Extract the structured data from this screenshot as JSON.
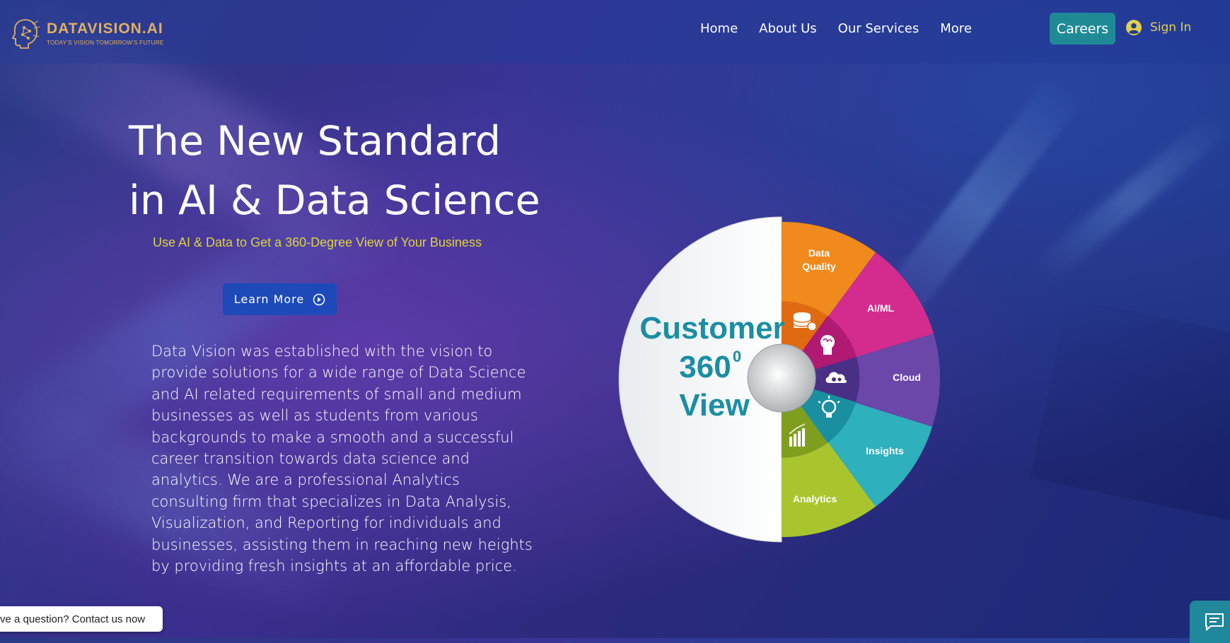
{
  "brand": {
    "name": "DATAVISION.AI",
    "tagline": "TODAY'S VISION TOMORROW'S FUTURE",
    "accent": "#e0b060"
  },
  "nav": {
    "items": [
      "Home",
      "About Us",
      "Our Services",
      "More"
    ]
  },
  "header": {
    "careers_label": "Careers",
    "signin_label": "Sign In"
  },
  "hero": {
    "title_line1": "The New Standard",
    "title_line2": "in AI & Data Science",
    "subtitle": "Use AI & Data to Get a 360-Degree View of Your Business",
    "cta_label": "Learn More",
    "description": "Data Vision was established with the vision to provide solutions for a wide range of Data Science and AI related requirements of small and medium businesses as well as students from various backgrounds to make a smooth and a successful career transition towards data science and analytics. We are a professional Analytics consulting firm that specializes in Data Analysis, Visualization, and Reporting for individuals and businesses, assisting them in reaching new heights by providing fresh insights at an affordable price."
  },
  "wheel": {
    "center_line1": "Customer",
    "center_line2": "360",
    "center_sup": "0",
    "center_line3": "View",
    "segments": [
      {
        "label_line1": "Data",
        "label_line2": "Quality",
        "color": "#f08a1c",
        "icon": "database-icon"
      },
      {
        "label_line1": "AI/ML",
        "label_line2": "",
        "color": "#d42c8e",
        "icon": "brain-icon"
      },
      {
        "label_line1": "Cloud",
        "label_line2": "",
        "color": "#6a47a8",
        "icon": "cloud-gear-icon"
      },
      {
        "label_line1": "Insights",
        "label_line2": "",
        "color": "#2fb0bd",
        "icon": "lightbulb-icon"
      },
      {
        "label_line1": "Analytics",
        "label_line2": "",
        "color": "#a9c52e",
        "icon": "bar-chart-icon"
      }
    ]
  },
  "widgets": {
    "contact_text": "ve a question? Contact us now"
  }
}
